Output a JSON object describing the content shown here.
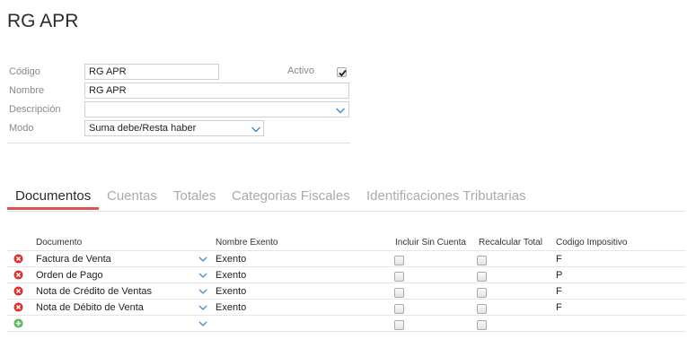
{
  "page": {
    "title": "RG APR"
  },
  "form": {
    "codigo": {
      "label": "Código",
      "value": "RG APR"
    },
    "activo": {
      "label": "Activo",
      "checked": true
    },
    "nombre": {
      "label": "Nombre",
      "value": "RG APR"
    },
    "descripcion": {
      "label": "Descripción",
      "value": ""
    },
    "modo": {
      "label": "Modo",
      "value": "Suma debe/Resta haber"
    }
  },
  "tabs": [
    {
      "label": "Documentos",
      "active": true
    },
    {
      "label": "Cuentas",
      "active": false
    },
    {
      "label": "Totales",
      "active": false
    },
    {
      "label": "Categorias Fiscales",
      "active": false
    },
    {
      "label": "Identificaciones Tributarias",
      "active": false
    }
  ],
  "grid": {
    "columns": {
      "documento": "Documento",
      "nombre_exento": "Nombre Exento",
      "incluir_sin_cuenta": "Incluir Sin Cuenta",
      "recalcular_total": "Recalcular Total",
      "codigo_impositivo": "Codigo Impositivo"
    },
    "rows": [
      {
        "documento": "Factura de Venta",
        "nombre_exento": "Exento",
        "incluir_sin_cuenta": false,
        "recalcular_total": false,
        "codigo_impositivo": "F"
      },
      {
        "documento": "Orden de Pago",
        "nombre_exento": "Exento",
        "incluir_sin_cuenta": false,
        "recalcular_total": false,
        "codigo_impositivo": "P"
      },
      {
        "documento": "Nota de Crédito de Ventas",
        "nombre_exento": "Exento",
        "incluir_sin_cuenta": false,
        "recalcular_total": false,
        "codigo_impositivo": "F"
      },
      {
        "documento": "Nota de Débito de Venta",
        "nombre_exento": "Exento",
        "incluir_sin_cuenta": false,
        "recalcular_total": false,
        "codigo_impositivo": "F"
      },
      {
        "documento": "",
        "nombre_exento": "",
        "incluir_sin_cuenta": false,
        "recalcular_total": false,
        "codigo_impositivo": ""
      }
    ]
  },
  "colors": {
    "accent": "#d9534f",
    "delete": "#d9322f",
    "add": "#5cb85c",
    "chevron": "#3a8fd6"
  },
  "icons": {
    "delete": "remove-circle-icon",
    "add": "add-circle-icon",
    "dropdown": "chevron-down-icon"
  }
}
